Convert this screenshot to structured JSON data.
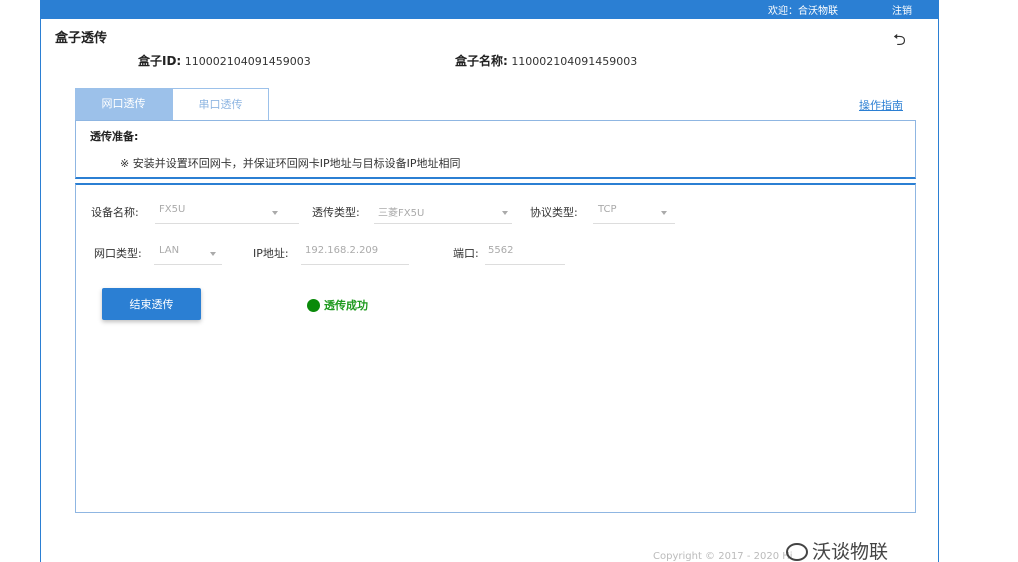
{
  "header": {
    "welcome": "欢迎：合沃物联",
    "logout": "注销"
  },
  "page": {
    "title": "盒子透传",
    "box_id_label": "盒子ID:",
    "box_id_value": "110002104091459003",
    "box_name_label": "盒子名称:",
    "box_name_value": "110002104091459003"
  },
  "tabs": [
    {
      "label": "网口透传",
      "active": true
    },
    {
      "label": "串口透传",
      "active": false
    }
  ],
  "guide_link": "操作指南",
  "prep": {
    "title": "透传准备:",
    "note": "※ 安装并设置环回网卡，并保证环回网卡IP地址与目标设备IP地址相同"
  },
  "form": {
    "device_name_label": "设备名称:",
    "device_name_value": "FX5U",
    "transfer_type_label": "透传类型:",
    "transfer_type_value": "三菱FX5U",
    "protocol_type_label": "协议类型:",
    "protocol_type_value": "TCP",
    "port_type_label": "网口类型:",
    "port_type_value": "LAN",
    "ip_label": "IP地址:",
    "ip_value": "192.168.2.209",
    "port_label": "端口:",
    "port_value": "5562",
    "end_button": "结束透传",
    "status": "透传成功"
  },
  "footer": {
    "copyright": "Copyright © 2017 - 2020 Hi",
    "watermark": "沃谈物联"
  },
  "colors": {
    "brand_blue": "#2b7fd3",
    "tab_active": "#9cc1ea",
    "success_green": "#0a8a0a"
  }
}
